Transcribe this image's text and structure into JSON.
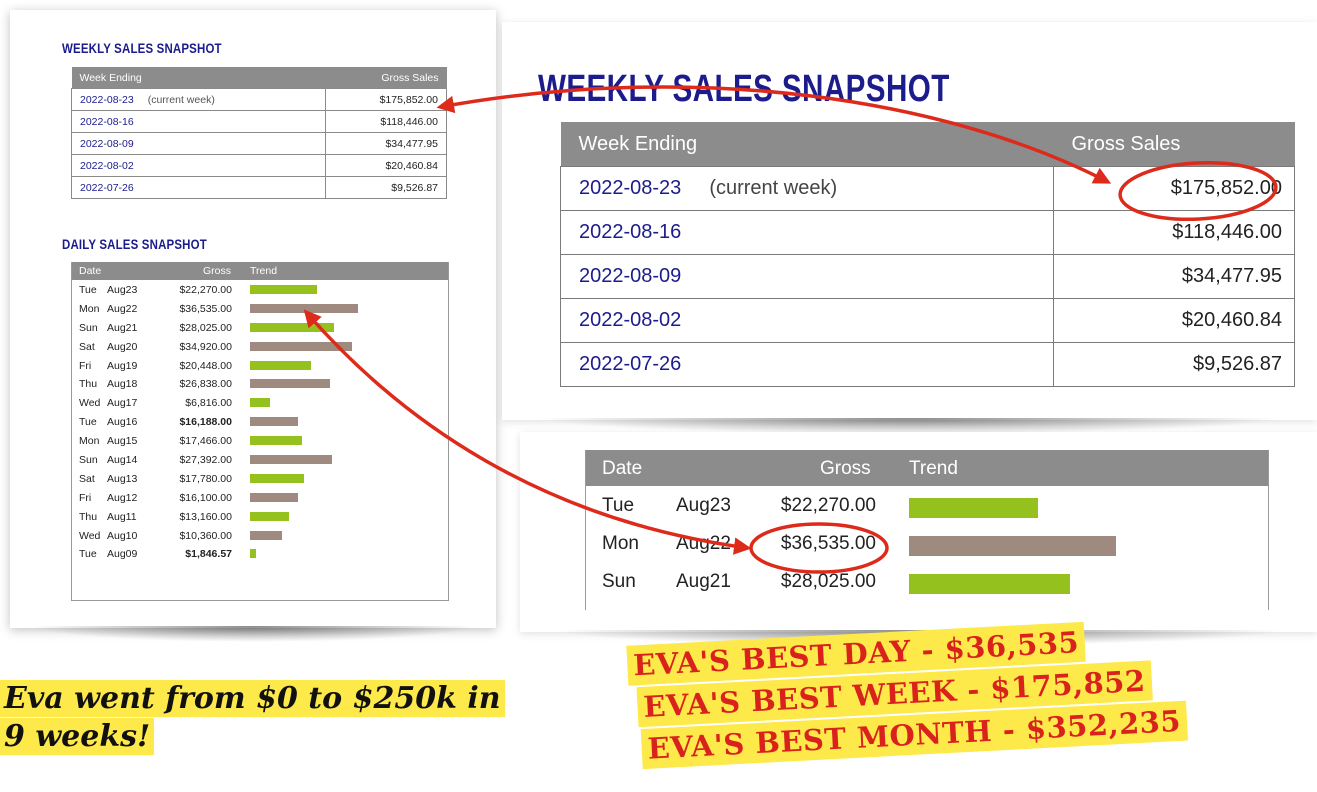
{
  "weekly_title": "WEEKLY SALES SNAPSHOT",
  "daily_title": "DAILY SALES SNAPSHOT",
  "weekly_headers": {
    "week_ending": "Week Ending",
    "gross_sales": "Gross Sales"
  },
  "weekly_rows": [
    {
      "date": "2022-08-23",
      "note": "(current week)",
      "gross": "$175,852.00"
    },
    {
      "date": "2022-08-16",
      "note": "",
      "gross": "$118,446.00"
    },
    {
      "date": "2022-08-09",
      "note": "",
      "gross": "$34,477.95"
    },
    {
      "date": "2022-08-02",
      "note": "",
      "gross": "$20,460.84"
    },
    {
      "date": "2022-07-26",
      "note": "",
      "gross": "$9,526.87"
    }
  ],
  "daily_headers": {
    "date": "Date",
    "gross": "Gross",
    "trend": "Trend"
  },
  "daily_rows": [
    {
      "dow": "Tue",
      "day": "Aug23",
      "gross": "$22,270.00",
      "trend": 0.36,
      "color": "green",
      "bold": false
    },
    {
      "dow": "Mon",
      "day": "Aug22",
      "gross": "$36,535.00",
      "trend": 0.58,
      "color": "brown",
      "bold": false
    },
    {
      "dow": "Sun",
      "day": "Aug21",
      "gross": "$28,025.00",
      "trend": 0.45,
      "color": "green",
      "bold": false
    },
    {
      "dow": "Sat",
      "day": "Aug20",
      "gross": "$34,920.00",
      "trend": 0.55,
      "color": "brown",
      "bold": false
    },
    {
      "dow": "Fri",
      "day": "Aug19",
      "gross": "$20,448.00",
      "trend": 0.33,
      "color": "green",
      "bold": false
    },
    {
      "dow": "Thu",
      "day": "Aug18",
      "gross": "$26,838.00",
      "trend": 0.43,
      "color": "brown",
      "bold": false
    },
    {
      "dow": "Wed",
      "day": "Aug17",
      "gross": "$6,816.00",
      "trend": 0.11,
      "color": "green",
      "bold": false
    },
    {
      "dow": "Tue",
      "day": "Aug16",
      "gross": "$16,188.00",
      "trend": 0.26,
      "color": "brown",
      "bold": true
    },
    {
      "dow": "Mon",
      "day": "Aug15",
      "gross": "$17,466.00",
      "trend": 0.28,
      "color": "green",
      "bold": false
    },
    {
      "dow": "Sun",
      "day": "Aug14",
      "gross": "$27,392.00",
      "trend": 0.44,
      "color": "brown",
      "bold": false
    },
    {
      "dow": "Sat",
      "day": "Aug13",
      "gross": "$17,780.00",
      "trend": 0.29,
      "color": "green",
      "bold": false
    },
    {
      "dow": "Fri",
      "day": "Aug12",
      "gross": "$16,100.00",
      "trend": 0.26,
      "color": "brown",
      "bold": false
    },
    {
      "dow": "Thu",
      "day": "Aug11",
      "gross": "$13,160.00",
      "trend": 0.21,
      "color": "green",
      "bold": false
    },
    {
      "dow": "Wed",
      "day": "Aug10",
      "gross": "$10,360.00",
      "trend": 0.17,
      "color": "brown",
      "bold": false
    },
    {
      "dow": "Tue",
      "day": "Aug09",
      "gross": "$1,846.57",
      "trend": 0.03,
      "color": "green",
      "bold": true
    }
  ],
  "colors": {
    "green": "#95c11f",
    "brown": "#9e8a7f",
    "title_blue": "#1c1c8c",
    "header_gray": "#8c8c8c",
    "arrow_red": "#dd2a1b",
    "highlight": "#fde94a"
  },
  "headline": {
    "line1": "Eva went from $0 to $250k in",
    "line2": "9 weeks!"
  },
  "best": {
    "day": "EVA'S BEST DAY - $36,535",
    "week": "EVA'S BEST WEEK - $175,852",
    "month": "EVA'S BEST MONTH - $352,235"
  }
}
